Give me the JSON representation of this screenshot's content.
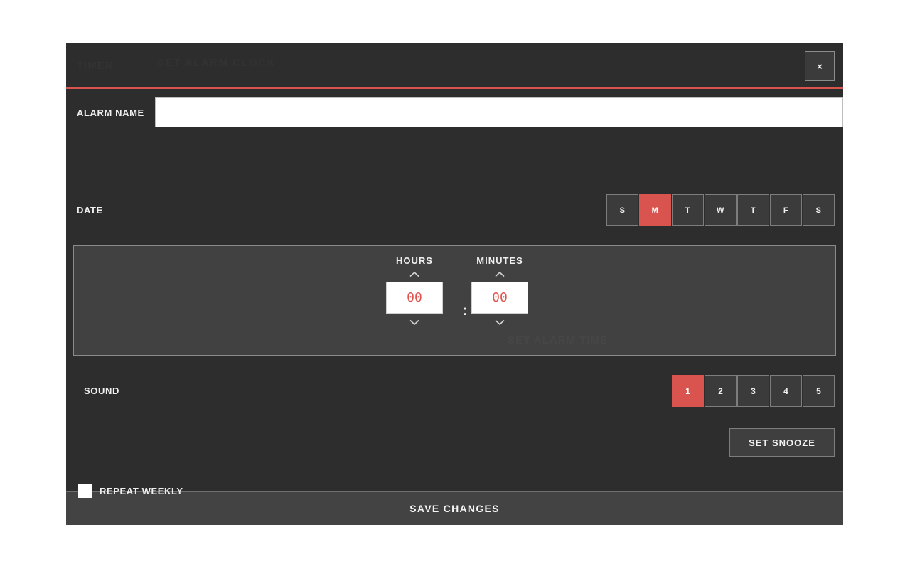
{
  "modal": {
    "header": {
      "ghost_title": "TIMER",
      "ghost_subtitle": "SET ALARM CLOCK",
      "close_label": "×"
    },
    "alarm_name": {
      "label": "ALARM NAME",
      "value": "",
      "placeholder": ""
    },
    "date": {
      "label": "DATE",
      "days": [
        {
          "label": "S",
          "selected": false
        },
        {
          "label": "M",
          "selected": true
        },
        {
          "label": "T",
          "selected": false
        },
        {
          "label": "W",
          "selected": false
        },
        {
          "label": "T",
          "selected": false
        },
        {
          "label": "F",
          "selected": false
        },
        {
          "label": "S",
          "selected": false
        }
      ]
    },
    "time": {
      "hours_label": "HOURS",
      "minutes_label": "MINUTES",
      "hours_value": "00",
      "minutes_value": "00",
      "separator": ":",
      "ghost_text": "SET ALARM TIME",
      "up_icon": "chevron-up-icon",
      "down_icon": "chevron-down-icon"
    },
    "sound": {
      "label": "SOUND",
      "options": [
        {
          "label": "1",
          "selected": true
        },
        {
          "label": "2",
          "selected": false
        },
        {
          "label": "3",
          "selected": false
        },
        {
          "label": "4",
          "selected": false
        },
        {
          "label": "5",
          "selected": false
        }
      ]
    },
    "snooze": {
      "label": "SET SNOOZE"
    },
    "repeat": {
      "label": "REPEAT WEEKLY",
      "checked": false
    },
    "footer": {
      "save_label": "SAVE CHANGES"
    }
  },
  "colors": {
    "accent": "#d9534f",
    "modal_background": "#2d2d2d",
    "panel_background": "#414141",
    "footer_background": "#434343",
    "text": "#efefef",
    "time_value": "#e0554f",
    "page_background": "#ffffff"
  }
}
